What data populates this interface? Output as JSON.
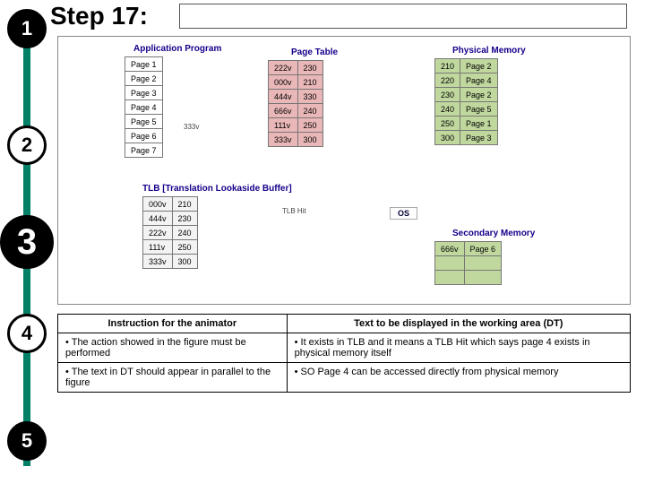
{
  "step_label": "Step 17:",
  "circles": [
    "1",
    "2",
    "3",
    "4",
    "5"
  ],
  "figure": {
    "app_prog_title": "Application Program",
    "page_table_title": "Page Table",
    "phys_mem_title": "Physical Memory",
    "tlb_title": "TLB [Translation Lookaside Buffer]",
    "sec_mem_title": "Secondary Memory",
    "os_label": "OS",
    "tlb_hint": "TLB Hit",
    "addr_hint": "333v",
    "app_pages": [
      "Page 1",
      "Page 2",
      "Page 3",
      "Page 4",
      "Page 5",
      "Page 6",
      "Page 7"
    ],
    "page_table": [
      [
        "222v",
        "230"
      ],
      [
        "000v",
        "210"
      ],
      [
        "444v",
        "330"
      ],
      [
        "666v",
        "240"
      ],
      [
        "111v",
        "250"
      ],
      [
        "333v",
        "300"
      ]
    ],
    "phys_mem": [
      [
        "210",
        "Page 2"
      ],
      [
        "220",
        "Page 4"
      ],
      [
        "230",
        "Page 2"
      ],
      [
        "240",
        "Page 5"
      ],
      [
        "250",
        "Page 1"
      ],
      [
        "300",
        "Page 3"
      ]
    ],
    "tlb": [
      [
        "000v",
        "210"
      ],
      [
        "444v",
        "230"
      ],
      [
        "222v",
        "240"
      ],
      [
        "111v",
        "250"
      ],
      [
        "333v",
        "300"
      ]
    ],
    "sec_mem": [
      [
        "666v",
        "Page 6"
      ]
    ]
  },
  "instructions": {
    "col1_header": "Instruction for the animator",
    "col2_header": "Text to be displayed in the working area (DT)",
    "col1_items": [
      "The action showed in the figure must be performed",
      "The text in DT should appear in parallel to the figure"
    ],
    "col2_items": [
      "It exists in TLB and it means a TLB Hit which says page 4 exists in physical memory itself",
      "SO Page 4 can be accessed directly from physical memory"
    ]
  }
}
